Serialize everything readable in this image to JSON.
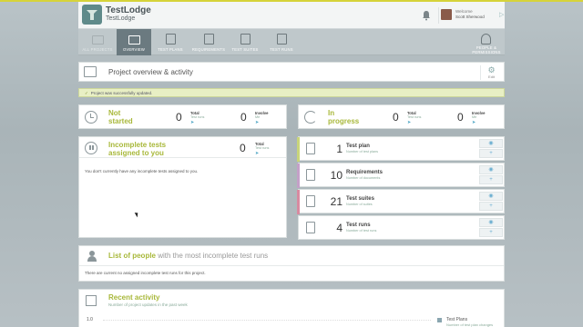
{
  "app": {
    "title": "TestLodge",
    "subtitle": "TestLodge"
  },
  "user": {
    "welcome": "Welcome",
    "name": "Scott Sherwood"
  },
  "nav": [
    {
      "label": "ALL PROJECTS",
      "icon": "folder-icon"
    },
    {
      "label": "OVERVIEW",
      "icon": "overview-icon"
    },
    {
      "label": "TEST PLANS",
      "icon": "test-plans-icon"
    },
    {
      "label": "REQUIREMENTS",
      "icon": "requirements-icon"
    },
    {
      "label": "TEST SUITES",
      "icon": "test-suites-icon"
    },
    {
      "label": "TEST RUNS",
      "icon": "test-runs-icon"
    },
    {
      "label": "PEOPLE & PERMISSIONS",
      "icon": "people-icon"
    }
  ],
  "overview": {
    "title": "Project overview & activity",
    "edit_label": "Edit"
  },
  "alert": {
    "message": "Project was successfully updated."
  },
  "not_started": {
    "title_line1": "Not",
    "title_line2": "started",
    "total_value": "0",
    "total_label": "Total",
    "total_sub": "Test runs",
    "involve_value": "0",
    "involve_label": "Involve",
    "involve_sub": "Me"
  },
  "in_progress": {
    "title_line1": "In",
    "title_line2": "progress",
    "total_value": "0",
    "total_label": "Total",
    "total_sub": "Test runs",
    "involve_value": "0",
    "involve_label": "Involve",
    "involve_sub": "Me"
  },
  "incomplete": {
    "title_line1": "Incomplete tests",
    "title_line2": "assigned to you",
    "count": "0",
    "total_label": "Total",
    "total_sub": "Test runs",
    "message": "You don't currently have any incomplete tests assigned to you."
  },
  "summary": [
    {
      "count": "1",
      "title": "Test plan",
      "sub": "Number of test plans",
      "color": "#c9d57a"
    },
    {
      "count": "10",
      "title": "Requirements",
      "sub": "Number of documents",
      "color": "#c4a0c8"
    },
    {
      "count": "21",
      "title": "Test suites",
      "sub": "Number of suites",
      "color": "#d88aa0"
    },
    {
      "count": "4",
      "title": "Test runs",
      "sub": "Number of test runs",
      "color": "#ffffff"
    }
  ],
  "people": {
    "title_strong": "List of people",
    "title_rest": " with the most incomplete test runs",
    "message": "There are current no assigned incomplete test runs for this project."
  },
  "activity": {
    "title": "Recent activity",
    "subtitle": "Number of project updates in the past week",
    "axis_top": "1.0",
    "legend_label": "Test Plans",
    "legend_sub": "Number of test plan changes"
  }
}
